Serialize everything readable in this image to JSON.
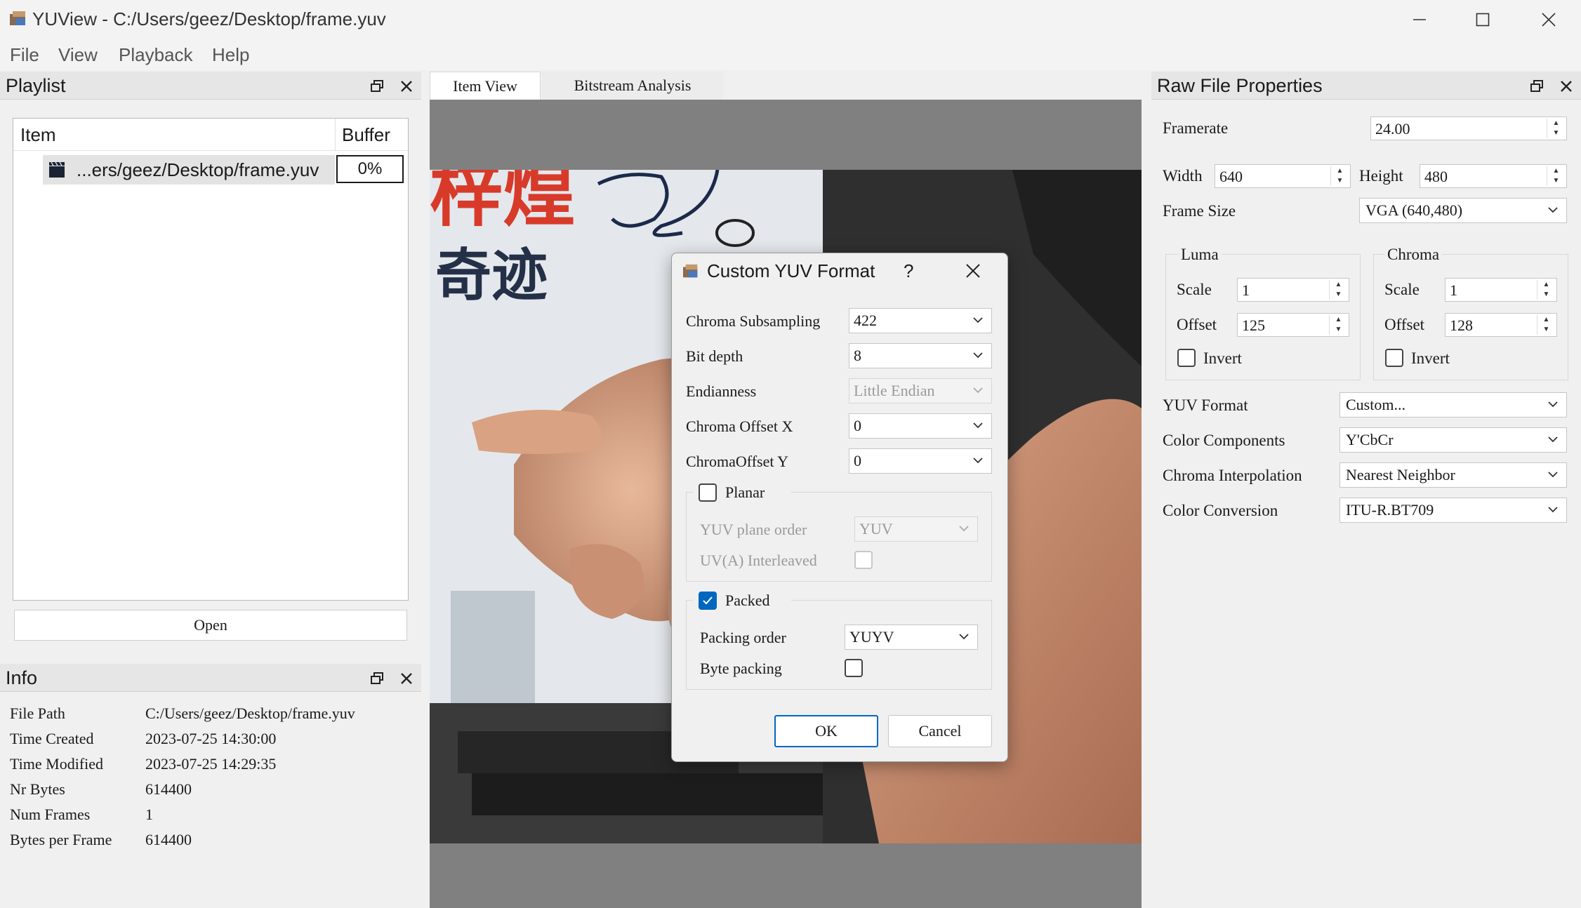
{
  "window": {
    "title": "YUView - C:/Users/geez/Desktop/frame.yuv"
  },
  "menu": [
    "File",
    "View",
    "Playback",
    "Help"
  ],
  "playlist": {
    "title": "Playlist",
    "col_item": "Item",
    "col_buffer": "Buffer",
    "row_name": "...ers/geez/Desktop/frame.yuv",
    "row_buffer": "0%",
    "open_label": "Open"
  },
  "info": {
    "title": "Info",
    "rows": [
      {
        "label": "File Path",
        "value": "C:/Users/geez/Desktop/frame.yuv"
      },
      {
        "label": "Time Created",
        "value": "2023-07-25 14:30:00"
      },
      {
        "label": "Time Modified",
        "value": "2023-07-25 14:29:35"
      },
      {
        "label": "Nr Bytes",
        "value": "614400"
      },
      {
        "label": "Num Frames",
        "value": "1"
      },
      {
        "label": "Bytes per Frame",
        "value": "614400"
      }
    ]
  },
  "tabs": [
    "Item View",
    "Bitstream Analysis"
  ],
  "properties": {
    "title": "Raw File Properties",
    "framerate_label": "Framerate",
    "framerate": "24.00",
    "width_label": "Width",
    "width": "640",
    "height_label": "Height",
    "height": "480",
    "framesize_label": "Frame Size",
    "framesize": "VGA (640,480)",
    "luma": {
      "title": "Luma",
      "scale_label": "Scale",
      "scale": "1",
      "offset_label": "Offset",
      "offset": "125",
      "invert_label": "Invert"
    },
    "chroma": {
      "title": "Chroma",
      "scale_label": "Scale",
      "scale": "1",
      "offset_label": "Offset",
      "offset": "128",
      "invert_label": "Invert"
    },
    "yuv_format_label": "YUV Format",
    "yuv_format": "Custom...",
    "color_components_label": "Color Components",
    "color_components": "Y'CbCr",
    "chroma_interp_label": "Chroma Interpolation",
    "chroma_interp": "Nearest Neighbor",
    "color_conversion_label": "Color Conversion",
    "color_conversion": "ITU-R.BT709"
  },
  "dialog": {
    "title": "Custom YUV Format",
    "help": "?",
    "subsampling_label": "Chroma Subsampling",
    "subsampling": "422",
    "bitdepth_label": "Bit depth",
    "bitdepth": "8",
    "endianness_label": "Endianness",
    "endianness": "Little Endian",
    "offx_label": "Chroma Offset X",
    "offx": "0",
    "offy_label": "ChromaOffset Y",
    "offy": "0",
    "planar_label": "Planar",
    "plane_order_label": "YUV plane order",
    "plane_order": "YUV",
    "uv_interleaved_label": "UV(A) Interleaved",
    "packed_label": "Packed",
    "packing_order_label": "Packing order",
    "packing_order": "YUYV",
    "byte_packing_label": "Byte packing",
    "ok_label": "OK",
    "cancel_label": "Cancel"
  },
  "frame_text": {
    "line1": "梓煌",
    "line2": "奇迹"
  },
  "colors": {
    "accent": "#0067c0",
    "view_gray": "#808080"
  },
  "icons": [
    "app-icon",
    "minimize-icon",
    "maximize-icon",
    "close-icon",
    "float-icon",
    "clapper-icon",
    "chevron-down-icon",
    "checkmark-icon"
  ]
}
